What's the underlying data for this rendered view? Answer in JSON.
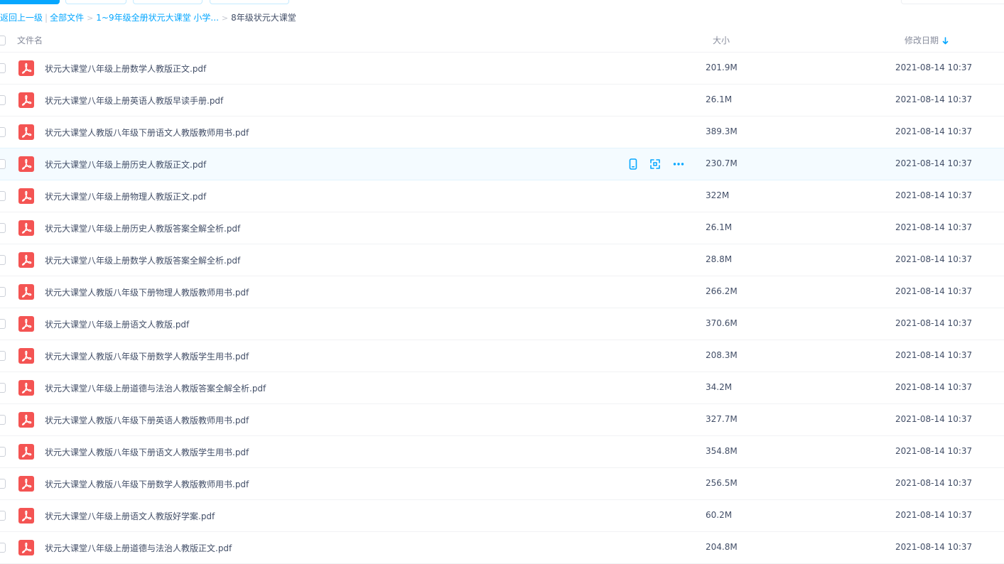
{
  "breadcrumb": {
    "back": "返回上一级",
    "all_files": "全部文件",
    "level1": "1~9年级全册状元大课堂 小学...",
    "current": "8年级状元大课堂"
  },
  "columns": {
    "name": "文件名",
    "size": "大小",
    "date": "修改日期"
  },
  "colors": {
    "accent": "#06a7ff",
    "pdf_red": "#f45453",
    "hover_bg": "#f4fbff"
  },
  "files": [
    {
      "name": "状元大课堂八年级上册数学人教版正文.pdf",
      "size": "201.9M",
      "date": "2021-08-14 10:37"
    },
    {
      "name": "状元大课堂八年级上册英语人教版早读手册.pdf",
      "size": "26.1M",
      "date": "2021-08-14 10:37"
    },
    {
      "name": "状元大课堂人教版八年级下册语文人教版教师用书.pdf",
      "size": "389.3M",
      "date": "2021-08-14 10:37"
    },
    {
      "name": "状元大课堂八年级上册历史人教版正文.pdf",
      "size": "230.7M",
      "date": "2021-08-14 10:37"
    },
    {
      "name": "状元大课堂八年级上册物理人教版正文.pdf",
      "size": "322M",
      "date": "2021-08-14 10:37"
    },
    {
      "name": "状元大课堂八年级上册历史人教版答案全解全析.pdf",
      "size": "26.1M",
      "date": "2021-08-14 10:37"
    },
    {
      "name": "状元大课堂八年级上册数学人教版答案全解全析.pdf",
      "size": "28.8M",
      "date": "2021-08-14 10:37"
    },
    {
      "name": "状元大课堂人教版八年级下册物理人教版教师用书.pdf",
      "size": "266.2M",
      "date": "2021-08-14 10:37"
    },
    {
      "name": "状元大课堂八年级上册语文人教版.pdf",
      "size": "370.6M",
      "date": "2021-08-14 10:37"
    },
    {
      "name": "状元大课堂人教版八年级下册数学人教版学生用书.pdf",
      "size": "208.3M",
      "date": "2021-08-14 10:37"
    },
    {
      "name": "状元大课堂八年级上册道德与法治人教版答案全解全析.pdf",
      "size": "34.2M",
      "date": "2021-08-14 10:37"
    },
    {
      "name": "状元大课堂人教版八年级下册英语人教版教师用书.pdf",
      "size": "327.7M",
      "date": "2021-08-14 10:37"
    },
    {
      "name": "状元大课堂人教版八年级下册语文人教版学生用书.pdf",
      "size": "354.8M",
      "date": "2021-08-14 10:37"
    },
    {
      "name": "状元大课堂人教版八年级下册数学人教版教师用书.pdf",
      "size": "256.5M",
      "date": "2021-08-14 10:37"
    },
    {
      "name": "状元大课堂八年级上册语文人教版好学案.pdf",
      "size": "60.2M",
      "date": "2021-08-14 10:37"
    },
    {
      "name": "状元大课堂八年级上册道德与法治人教版正文.pdf",
      "size": "204.8M",
      "date": "2021-08-14 10:37"
    }
  ],
  "hover_row": 3,
  "row_actions": [
    "phone-icon",
    "share-icon",
    "more-icon"
  ]
}
